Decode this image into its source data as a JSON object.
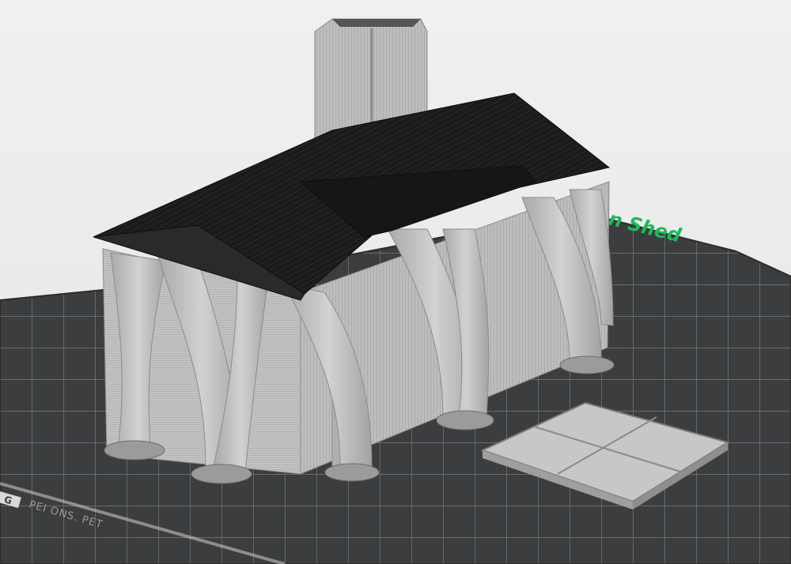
{
  "viewport": {
    "bed_label": "Garden Shed",
    "bed_label_visible": "n Shed",
    "bed_brand_text": "PEI ONS. PET",
    "bed_logo_glyph": "G",
    "colors": {
      "background": "#ececec",
      "plate": "#3b3d3e",
      "grid_line": "#7c8083",
      "label_green": "#1fb85a",
      "model_gray": "#b8b8b8",
      "roof_black": "#1a1a1a"
    },
    "objects": [
      "shed-body",
      "roof",
      "chimney",
      "tree-supports",
      "door-panel"
    ]
  }
}
